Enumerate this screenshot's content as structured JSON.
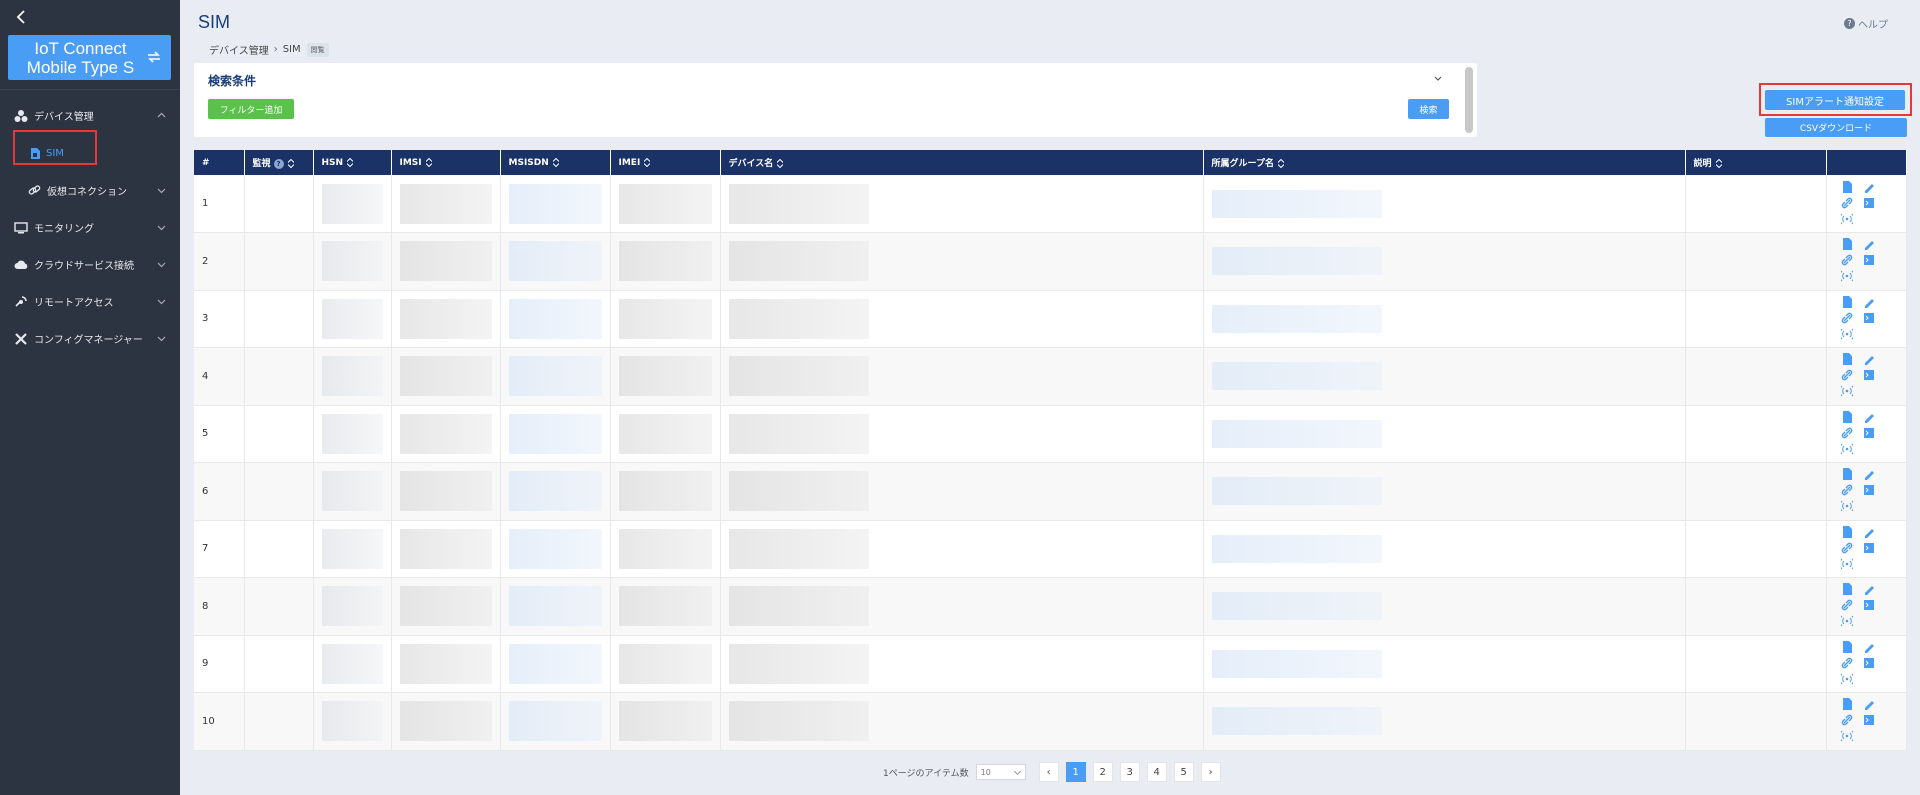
{
  "page": {
    "title": "SIM",
    "help": "ヘルプ"
  },
  "sidebar": {
    "brand": "IoT Connect\nMobile Type S",
    "items": [
      {
        "label": "デバイス管理"
      },
      {
        "label": "SIM"
      },
      {
        "label": "仮想コネクション"
      },
      {
        "label": "モニタリング"
      },
      {
        "label": "クラウドサービス接続"
      },
      {
        "label": "リモートアクセス"
      },
      {
        "label": "コンフィグマネージャー"
      }
    ]
  },
  "breadcrumb": {
    "parent": "デバイス管理",
    "current": "SIM",
    "tag": "閲覧"
  },
  "search": {
    "title": "検索条件",
    "add_filter": "フィルター追加",
    "search_button": "検索"
  },
  "actions": {
    "alert_settings": "SIMアラート通知設定",
    "csv_download": "CSVダウンロード"
  },
  "table": {
    "headers": {
      "index": "#",
      "monitor": "監視",
      "hsn": "HSN",
      "imsi": "IMSI",
      "msisdn": "MSISDN",
      "imei": "IMEI",
      "device_name": "デバイス名",
      "group": "所属グループ名",
      "description": "説明"
    },
    "rows": [
      {
        "index": "1"
      },
      {
        "index": "2"
      },
      {
        "index": "3"
      },
      {
        "index": "4"
      },
      {
        "index": "5"
      },
      {
        "index": "6"
      },
      {
        "index": "7"
      },
      {
        "index": "8"
      },
      {
        "index": "9"
      },
      {
        "index": "10"
      }
    ]
  },
  "pagination": {
    "items_per_page_label": "1ページのアイテム数",
    "items_per_page": "10",
    "pages": [
      "1",
      "2",
      "3",
      "4",
      "5"
    ],
    "current": "1"
  },
  "colors": {
    "sidebar": "#2d3441",
    "accent": "#4a9df5",
    "header": "#1a3266",
    "green": "#5ac14b",
    "highlight": "#e53935"
  }
}
